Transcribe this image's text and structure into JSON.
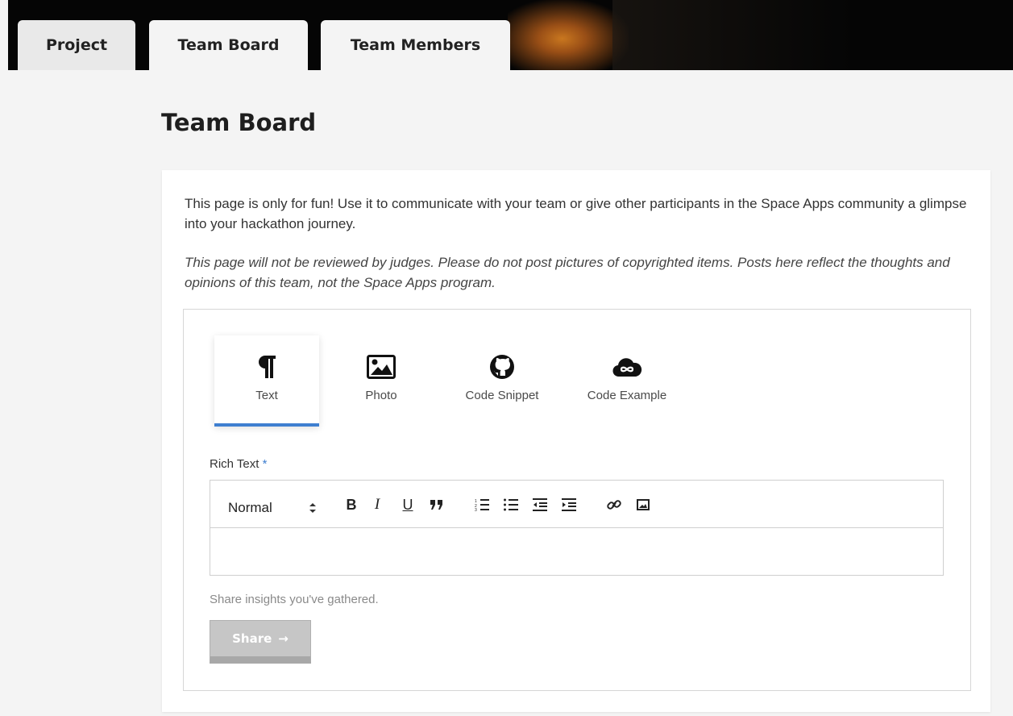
{
  "tabs": [
    {
      "label": "Project"
    },
    {
      "label": "Team Board"
    },
    {
      "label": "Team Members"
    }
  ],
  "page_title": "Team Board",
  "intro_text": "This page is only for fun! Use it to communicate with your team or give other participants in the Space Apps community a glimpse into your hackathon journey.",
  "disclaimer_text": "This page will not be reviewed by judges. Please do not post pictures of copyrighted items. Posts here reflect the thoughts and opinions of this team, not the Space Apps program.",
  "post_types": [
    {
      "label": "Text",
      "icon": "pilcrow-icon"
    },
    {
      "label": "Photo",
      "icon": "image-icon"
    },
    {
      "label": "Code Snippet",
      "icon": "github-icon"
    },
    {
      "label": "Code Example",
      "icon": "cloud-infinity-icon"
    }
  ],
  "field_label": "Rich Text",
  "required_marker": "*",
  "toolbar": {
    "format_select": "Normal",
    "bold": "B",
    "italic": "I",
    "underline": "U",
    "quote": "99"
  },
  "helper_text": "Share insights you've gathered.",
  "share_button": {
    "label": "Share",
    "arrow": "→"
  },
  "colors": {
    "accent": "#3f7fd0",
    "disabled_button": "#c6c6c6"
  }
}
